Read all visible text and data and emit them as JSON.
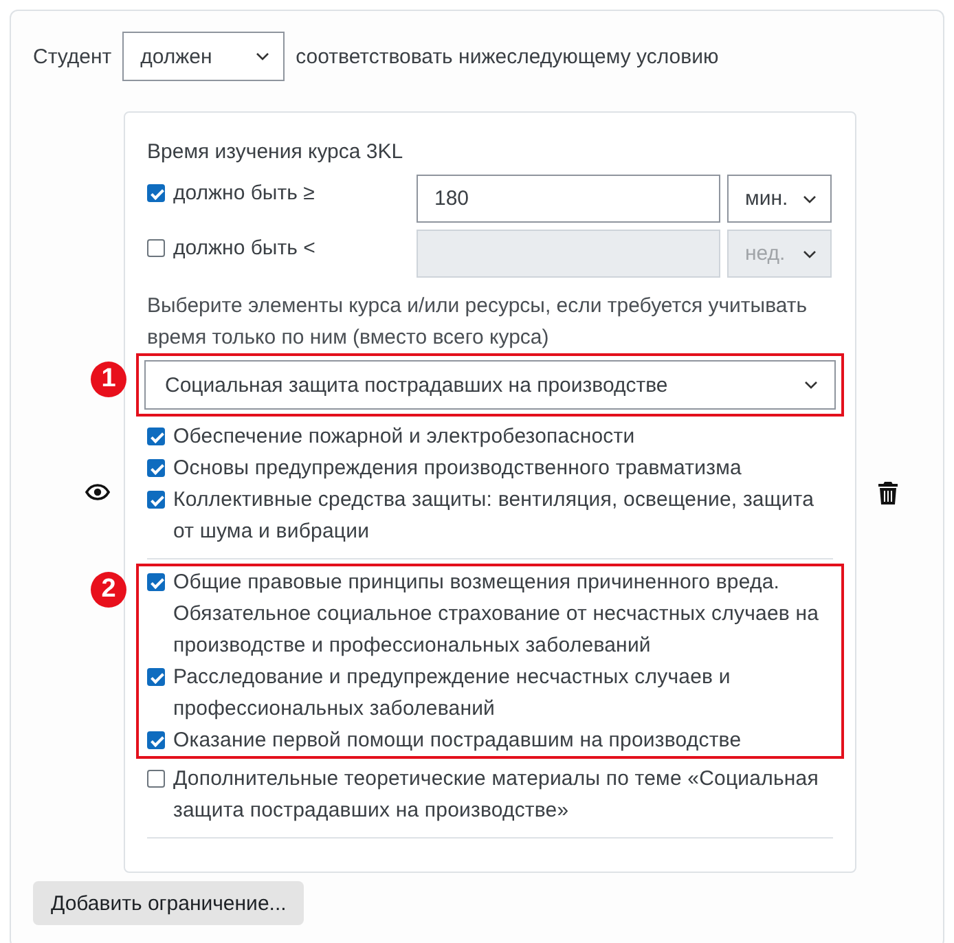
{
  "condition": {
    "subject": "Студент",
    "mode": "должен",
    "suffix": "соответствовать нижеследующему условию"
  },
  "restriction": {
    "title": "Время изучения курса 3KL",
    "limits": [
      {
        "label": "должно быть ≥",
        "checked": true,
        "disabled": false,
        "value": "180",
        "unit": "мин."
      },
      {
        "label": "должно быть <",
        "checked": false,
        "disabled": true,
        "unit": "нед."
      }
    ],
    "hint": "Выберите элементы курса и/или ресурсы, если требуется учитывать время только по ним (вместо всего курса)",
    "section_select": {
      "value": "Социальная защита пострадавших на производстве",
      "highlighted": true,
      "badge": "1"
    },
    "item_groups": [
      {
        "highlighted": false,
        "items": [
          {
            "label": "Обеспечение пожарной и электробезопасности",
            "checked": true
          },
          {
            "label": "Основы предупреждения производственного травматизма",
            "checked": true
          },
          {
            "label": "Коллективные средства защиты: вентиляция, освещение, защита от шума и вибрации",
            "checked": true
          }
        ]
      },
      {
        "highlighted": true,
        "badge": "2",
        "items": [
          {
            "label": "Общие правовые принципы возмещения причиненного вреда. Обязательное социальное страхование от несчастных случаев на производстве и профессиональных заболеваний",
            "checked": true
          },
          {
            "label": "Расследование и предупреждение несчастных случаев и профессиональных заболеваний",
            "checked": true
          },
          {
            "label": "Оказание первой помощи пострадавшим на производстве",
            "checked": true
          }
        ]
      },
      {
        "highlighted": false,
        "items": [
          {
            "label": "Дополнительные теоретические материалы по теме «Социальная защита пострадавших на производстве»",
            "checked": false
          }
        ]
      }
    ]
  },
  "add_button": "Добавить ограничение..."
}
